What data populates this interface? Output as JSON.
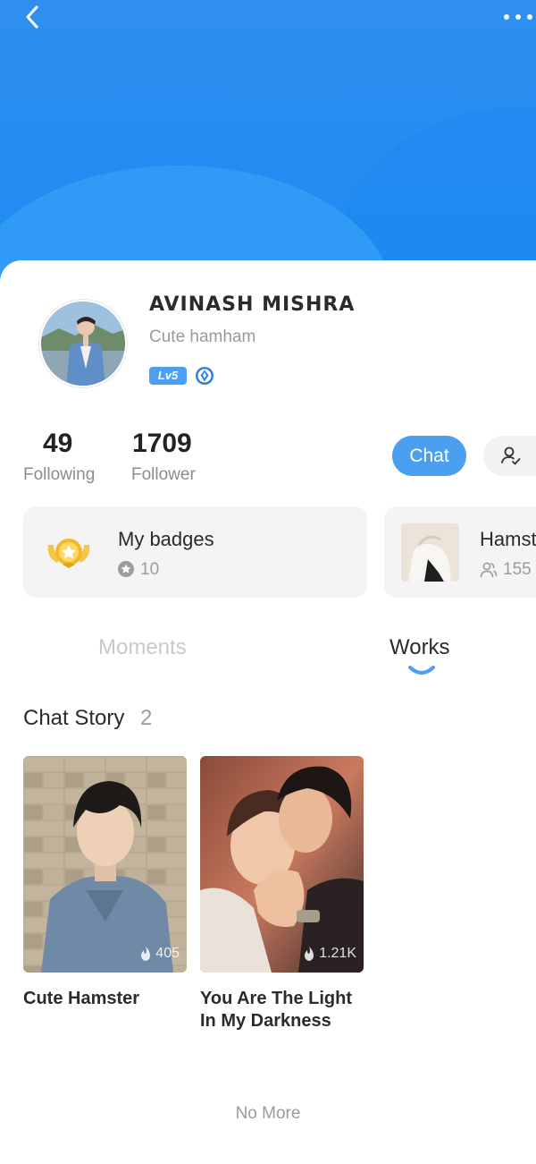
{
  "header": {
    "back_icon": "chevron-left-icon",
    "more_icon": "more-dots-icon"
  },
  "profile": {
    "name": "AVINASH MISHRA",
    "bio": "Cute hamham",
    "level_badge": "Lv5",
    "vip_icon": "diamond-icon"
  },
  "stats": [
    {
      "value": "49",
      "label": "Following"
    },
    {
      "value": "1709",
      "label": "Follower"
    }
  ],
  "actions": {
    "chat_label": "Chat",
    "follow_icon": "user-check-icon"
  },
  "badges_card": {
    "title": "My badges",
    "count": "10",
    "icon": "badge-medal-icon"
  },
  "group_card": {
    "title": "Hamst",
    "count": "155",
    "icon": "people-icon"
  },
  "tabs": [
    {
      "label": "Moments",
      "active": false
    },
    {
      "label": "Works",
      "active": true
    }
  ],
  "section": {
    "title": "Chat Story",
    "count": "2"
  },
  "stories": [
    {
      "title": "Cute Hamster",
      "views": "405"
    },
    {
      "title": "You Are The Light In My Darkness",
      "views": "1.21K"
    }
  ],
  "footer": {
    "no_more": "No More"
  },
  "colors": {
    "primary": "#4b9ff1",
    "header_blue": "#1d8bf2",
    "panel_bg": "#f4f4f5"
  }
}
